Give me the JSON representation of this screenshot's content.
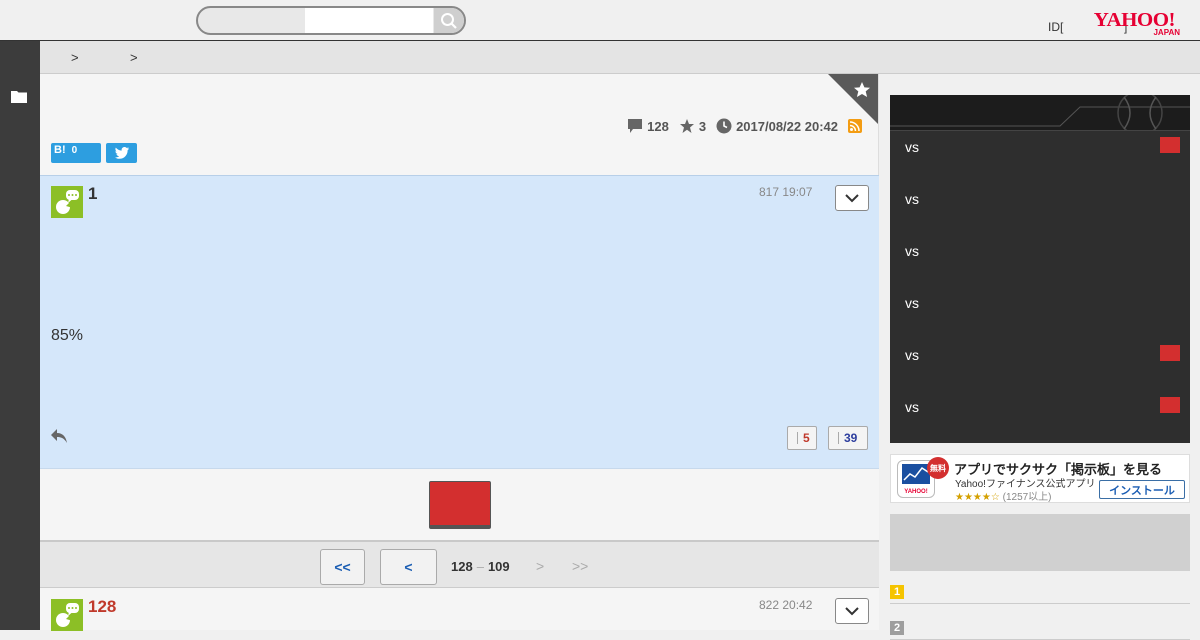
{
  "header": {
    "search_placeholder": "",
    "id_label": "ID[",
    "id_bracket_close": "]",
    "logo_text": "YAHOO!",
    "logo_sub": "JAPAN"
  },
  "breadcrumb": {
    "sep1": ">",
    "sep2": ">"
  },
  "thread": {
    "comments": "128",
    "stars": "3",
    "datetime": "2017/08/22 20:42",
    "hatena_count": "0",
    "hatena_label": "B!"
  },
  "posts": [
    {
      "number": "1",
      "date": "817 19:07",
      "text": "85%",
      "votes_down": "5",
      "votes_up": "39"
    },
    {
      "number": "128",
      "date": "822 20:42"
    }
  ],
  "pager": {
    "first": "<<",
    "prev": "<",
    "range_start": "128",
    "range_dash": "–",
    "range_end": "109",
    "next": ">",
    "last": ">>"
  },
  "scoreboard": {
    "rows": [
      {
        "vs": "vs",
        "badge": true
      },
      {
        "vs": "vs",
        "badge": false
      },
      {
        "vs": "vs",
        "badge": false
      },
      {
        "vs": "vs",
        "badge": false
      },
      {
        "vs": "vs",
        "badge": true
      },
      {
        "vs": "vs",
        "badge": true
      }
    ]
  },
  "app_ad": {
    "free_label": "無料",
    "title": "アプリでサクサク「掲示板」を見る",
    "subtitle": "Yahoo!ファイナンス公式アプリ",
    "stars": "★★★★☆",
    "rating_count": "(1257以上)",
    "install_label": "インストール",
    "icon_text": "YAHOO!"
  },
  "ranking": [
    {
      "n": "1",
      "color": "#f5c400"
    },
    {
      "n": "2",
      "color": "#9e9e9e"
    }
  ],
  "colors": {
    "accent_red": "#d32f2f",
    "post_highlight": "#d5e7fa",
    "avatar_green": "#8cbf26",
    "link_blue": "#1a5db3"
  }
}
